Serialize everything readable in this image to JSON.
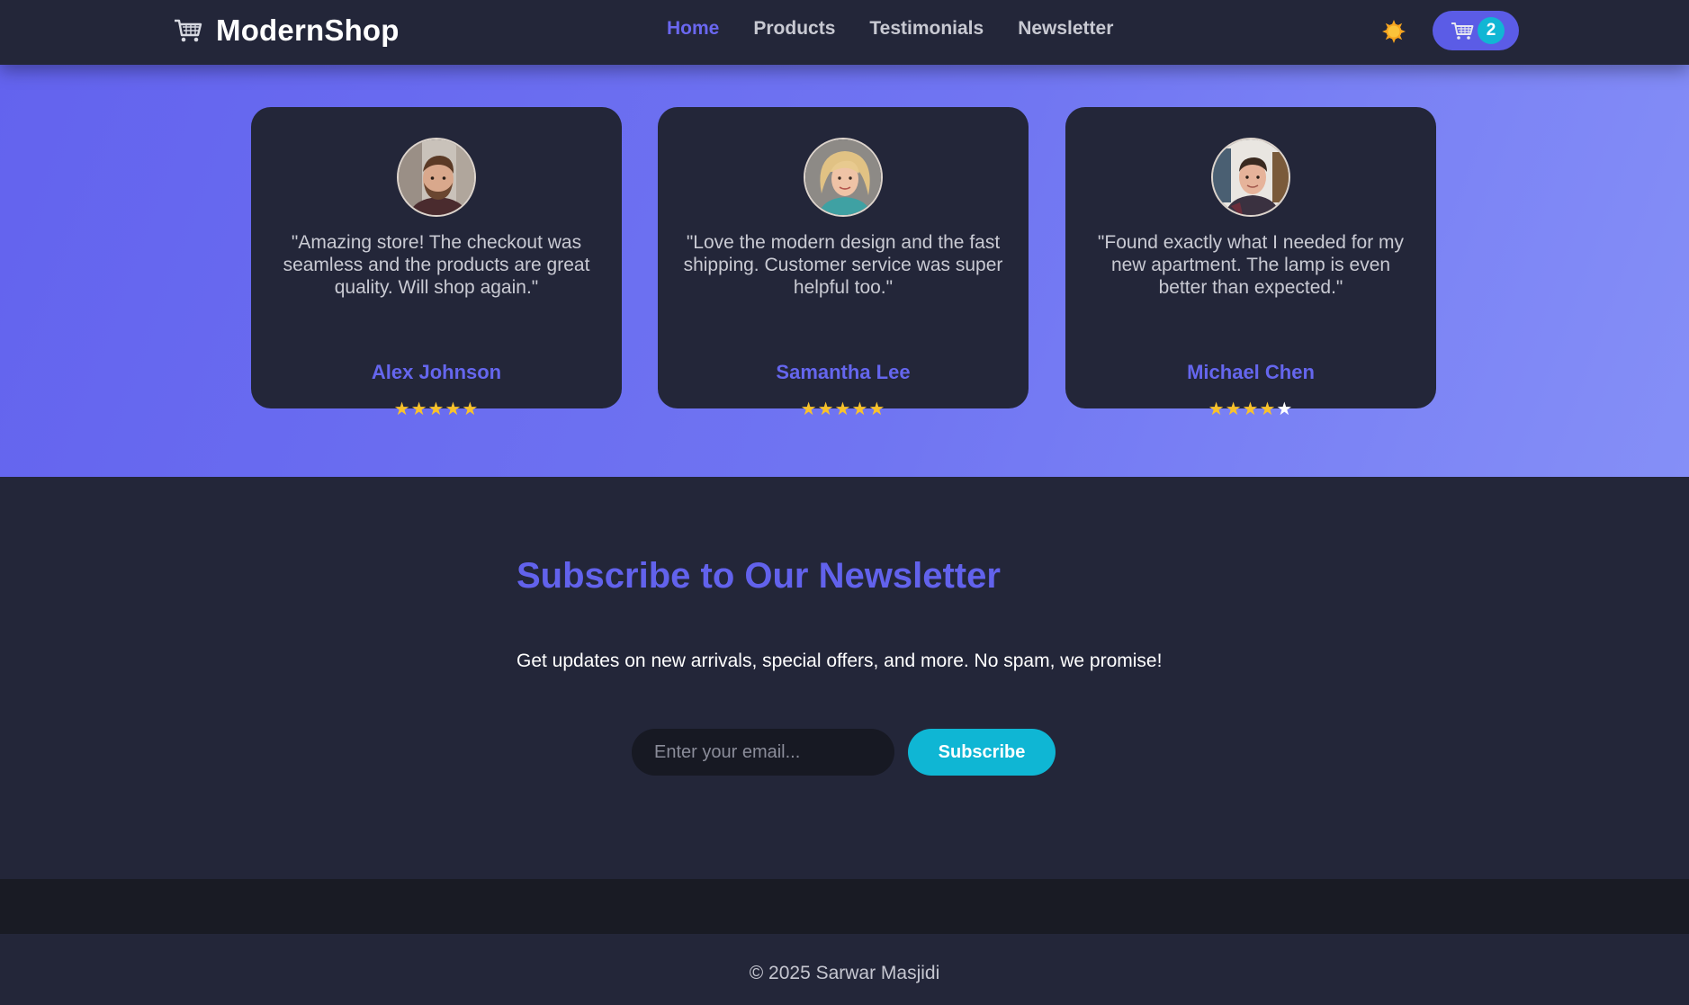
{
  "nav": {
    "brand": "ModernShop",
    "brand_icon": "shopping-cart-icon",
    "links": [
      {
        "label": "Home",
        "active": true
      },
      {
        "label": "Products",
        "active": false
      },
      {
        "label": "Testimonials",
        "active": false
      },
      {
        "label": "Newsletter",
        "active": false
      }
    ],
    "theme_icon": "sun-icon",
    "cart_icon": "shopping-cart-icon",
    "cart_count": "2"
  },
  "testimonials": [
    {
      "quote": "\"Amazing store! The checkout was seamless and the products are great quality. Will shop again.\"",
      "author": "Alex Johnson",
      "rating": 5
    },
    {
      "quote": "\"Love the modern design and the fast shipping. Customer service was super helpful too.\"",
      "author": "Samantha Lee",
      "rating": 5
    },
    {
      "quote": "\"Found exactly what I needed for my new apartment. The lamp is even better than expected.\"",
      "author": "Michael Chen",
      "rating": 4
    }
  ],
  "newsletter": {
    "title": "Subscribe to Our Newsletter",
    "description": "Get updates on new arrivals, special offers, and more. No spam, we promise!",
    "email_placeholder": "Enter your email...",
    "button_label": "Subscribe"
  },
  "footer": {
    "copyright": "© 2025 Sarwar Masjidi"
  },
  "colors": {
    "accent": "#6566ee",
    "cyan": "#0fb6d4",
    "star": "#f8c22c",
    "background": "#232639"
  }
}
